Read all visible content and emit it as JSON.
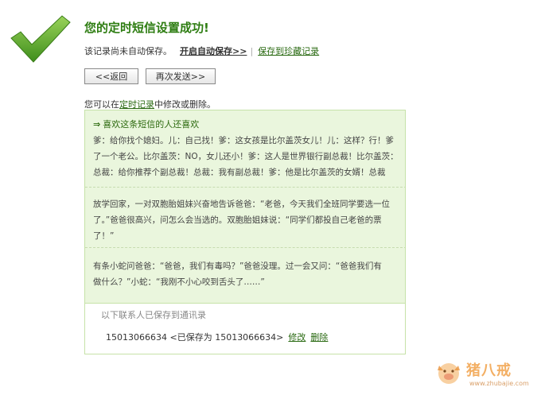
{
  "status": {
    "title": "您的定时短信设置成功!",
    "icon": "checkmark-icon",
    "icon_color": "#5aa428"
  },
  "save_note": {
    "text": "该记录尚未自动保存。",
    "auto_save_link": "开启自动保存>>",
    "divider": "|",
    "favorite_link": "保存到珍藏记录"
  },
  "buttons": {
    "back": "<<返回",
    "resend": "再次发送>>"
  },
  "edit_note": {
    "prefix": "您可以在",
    "link": "定时记录",
    "suffix": "中修改或删除。"
  },
  "recommend": {
    "arrow": "⇒",
    "heading": "喜欢这条短信的人还喜欢",
    "messages": [
      "爹：给你找个媳妇。儿：自己找！爹：这女孩是比尔盖茨女儿！儿：这样？行！爹\n了一个老公。比尔盖茨：NO，女儿还小！爹：这人是世界银行副总裁！比尔盖茨：\n总裁：给你推荐个副总裁！总裁：我有副总裁！爹：他是比尔盖茨的女婿！总裁",
      "放学回家，一对双胞胎姐妹兴奋地告诉爸爸：“老爸，今天我们全班同学要选一位\n了。”爸爸很高兴，问怎么会当选的。双胞胎姐妹说：“同学们都投自己老爸的票\n了！”",
      "有条小蛇问爸爸：“爸爸，我们有毒吗？”爸爸没理。过一会又问：“爸爸我们有\n做什么？”小蛇：“我刚不小心咬到舌头了……”"
    ]
  },
  "contacts": {
    "label": "以下联系人已保存到通讯录",
    "entry": "15013066634 <已保存为 15013066634>",
    "edit_link": "修改",
    "delete_link": "删除"
  },
  "watermark": {
    "brand": "猪八戒",
    "url": "www.zhubajie.com"
  }
}
